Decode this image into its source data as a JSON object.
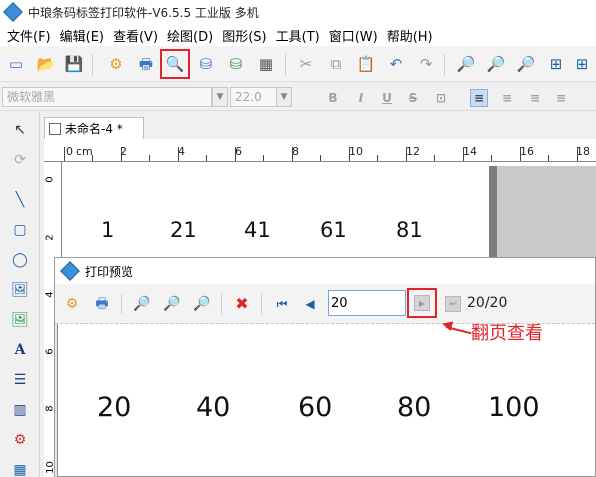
{
  "window": {
    "title": "中琅条码标签打印软件-V6.5.5 工业版 多机"
  },
  "menu": [
    "文件(F)",
    "编辑(E)",
    "查看(V)",
    "绘图(D)",
    "图形(S)",
    "工具(T)",
    "窗口(W)",
    "帮助(H)"
  ],
  "format_bar": {
    "font_name": "微软雅黑",
    "font_size": "22.0",
    "bold": "B",
    "italic": "I",
    "underline": "U",
    "strike": "S"
  },
  "document": {
    "tab_label": "未命名-4 *"
  },
  "ruler": {
    "unit": "cm",
    "top_labels": [
      "0",
      "2",
      "4",
      "6",
      "8",
      "10",
      "12",
      "14",
      "16",
      "18"
    ],
    "left_labels": [
      "0",
      "2",
      "4",
      "6",
      "8",
      "10"
    ]
  },
  "canvas_numbers": [
    "1",
    "21",
    "41",
    "61",
    "81"
  ],
  "preview": {
    "title": "打印预览",
    "page_input": "20",
    "page_count": "20/20",
    "numbers": [
      "20",
      "40",
      "60",
      "80",
      "100"
    ]
  },
  "annotation": {
    "text": "翻页查看",
    "color": "#e0252a"
  },
  "colors": {
    "highlight": "#e0252a",
    "accent": "#3c8fd8"
  }
}
